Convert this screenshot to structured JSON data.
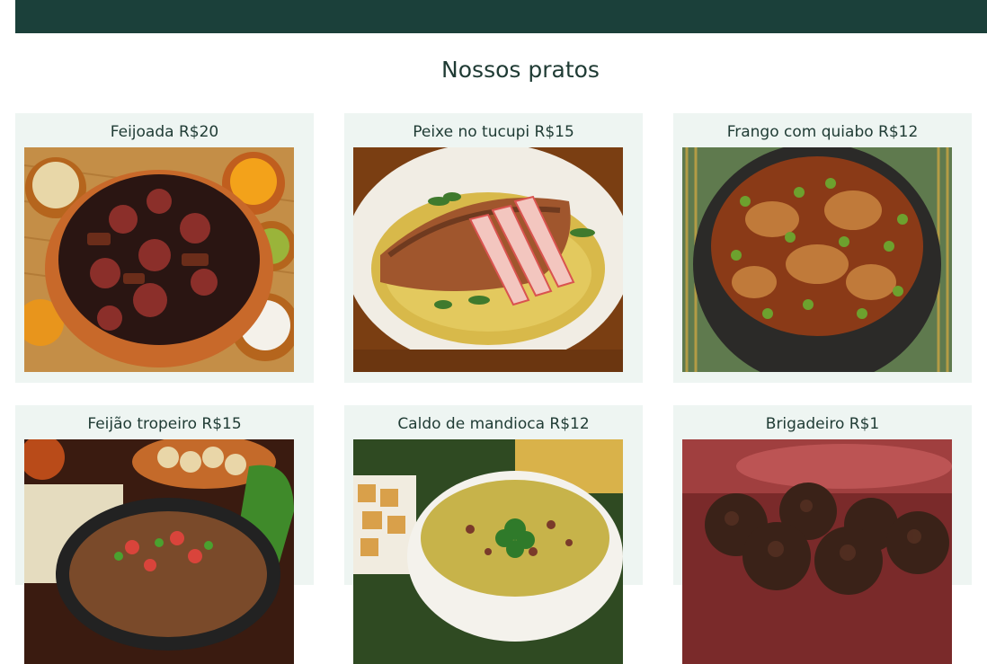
{
  "header": {
    "background_color": "#1b403a"
  },
  "section": {
    "title": "Nossos pratos"
  },
  "dishes": [
    {
      "label": "Feijoada R$20",
      "image": "feijoada-photo"
    },
    {
      "label": "Peixe no tucupi R$15",
      "image": "fish-photo"
    },
    {
      "label": "Frango com quiabo R$12",
      "image": "chicken-okra-photo"
    },
    {
      "label": "Feijão tropeiro R$15",
      "image": "tropeiro-photo"
    },
    {
      "label": "Caldo de mandioca R$12",
      "image": "cassava-soup-photo"
    },
    {
      "label": "Brigadeiro R$1",
      "image": "brigadeiro-photo"
    }
  ]
}
